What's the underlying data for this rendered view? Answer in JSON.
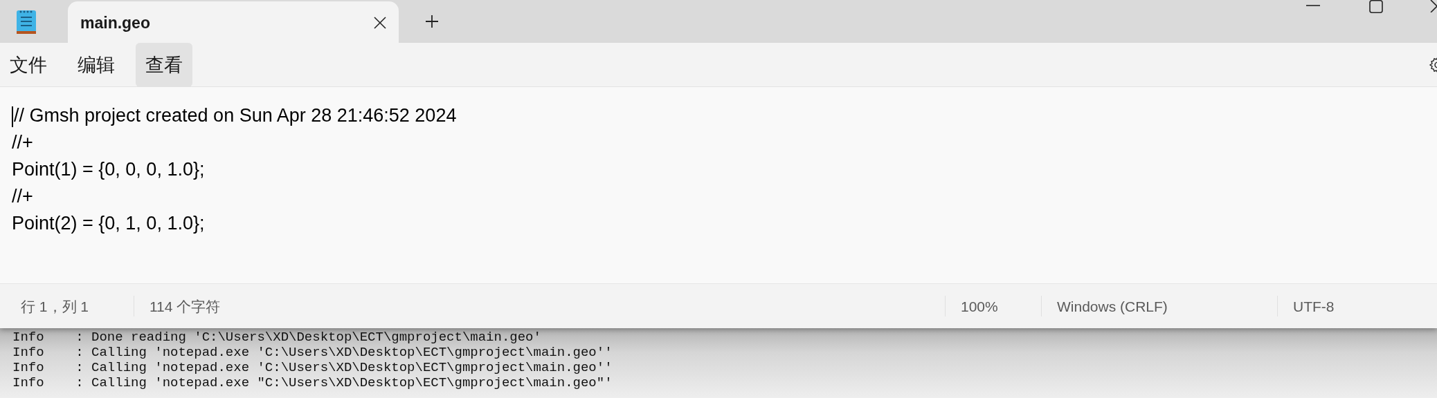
{
  "tabs": [
    {
      "label": "main.geo",
      "selected": true
    }
  ],
  "menu": [
    {
      "label": "文件",
      "highlighted": false
    },
    {
      "label": "编辑",
      "highlighted": false
    },
    {
      "label": "查看",
      "highlighted": true
    }
  ],
  "editor": {
    "lines": [
      "// Gmsh project created on Sun Apr 28 21:46:52 2024",
      "//+",
      "Point(1) = {0, 0, 0, 1.0};",
      "//+",
      "Point(2) = {0, 1, 0, 1.0};"
    ]
  },
  "status_bar": [
    "行 1，列 1",
    "114 个字符",
    "100%",
    "Windows (CRLF)",
    "UTF-8"
  ],
  "console": {
    "lines": [
      "Info    : Done reading 'C:\\Users\\XD\\Desktop\\ECT\\gmproject\\main.geo'",
      "Info    : Calling 'notepad.exe 'C:\\Users\\XD\\Desktop\\ECT\\gmproject\\main.geo''",
      "Info    : Calling 'notepad.exe 'C:\\Users\\XD\\Desktop\\ECT\\gmproject\\main.geo''",
      "Info    : Calling 'notepad.exe \"C:\\Users\\XD\\Desktop\\ECT\\gmproject\\main.geo\"'"
    ]
  }
}
